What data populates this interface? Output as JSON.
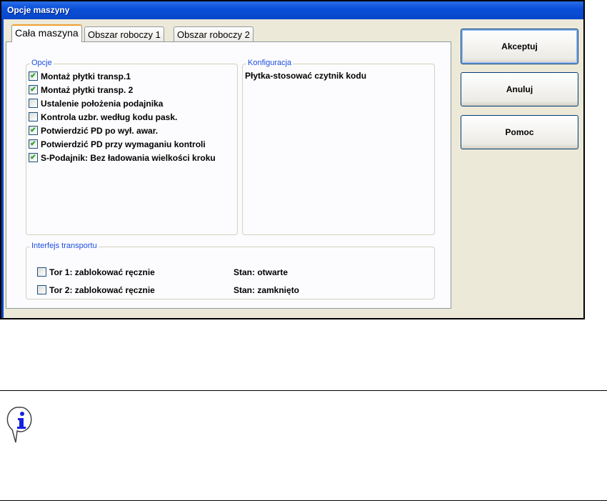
{
  "window": {
    "title": "Opcje maszyny"
  },
  "tabs": [
    {
      "label": "Cała maszyna",
      "active": true
    },
    {
      "label": "Obszar roboczy 1"
    },
    {
      "label": "Obszar roboczy 2"
    }
  ],
  "options": {
    "legend": "Opcje",
    "items": [
      {
        "label": "Montaż płytki transp.1",
        "checked": true
      },
      {
        "label": "Montaż płytki transp. 2",
        "checked": true
      },
      {
        "label": "Ustalenie położenia podajnika",
        "checked": false
      },
      {
        "label": "Kontrola uzbr. według kodu pask.",
        "checked": false
      },
      {
        "label": "Potwierdzić PD po wył. awar.",
        "checked": true
      },
      {
        "label": "Potwierdzić PD przy wymaganiu kontroli",
        "checked": true
      },
      {
        "label": "S-Podajnik: Bez ładowania wielkości kroku",
        "checked": true
      }
    ]
  },
  "config": {
    "legend": "Konfiguracja",
    "text": "Płytka-stosować czytnik kodu"
  },
  "transport": {
    "legend": "Interfejs transportu",
    "rows": [
      {
        "label": "Tor 1: zablokować ręcznie",
        "checked": false,
        "status": "Stan: otwarte"
      },
      {
        "label": "Tor 2: zablokować ręcznie",
        "checked": false,
        "status": "Stan: zamknięto"
      }
    ]
  },
  "buttons": {
    "accept": "Akceptuj",
    "cancel": "Anuluj",
    "help": "Pomoc"
  }
}
